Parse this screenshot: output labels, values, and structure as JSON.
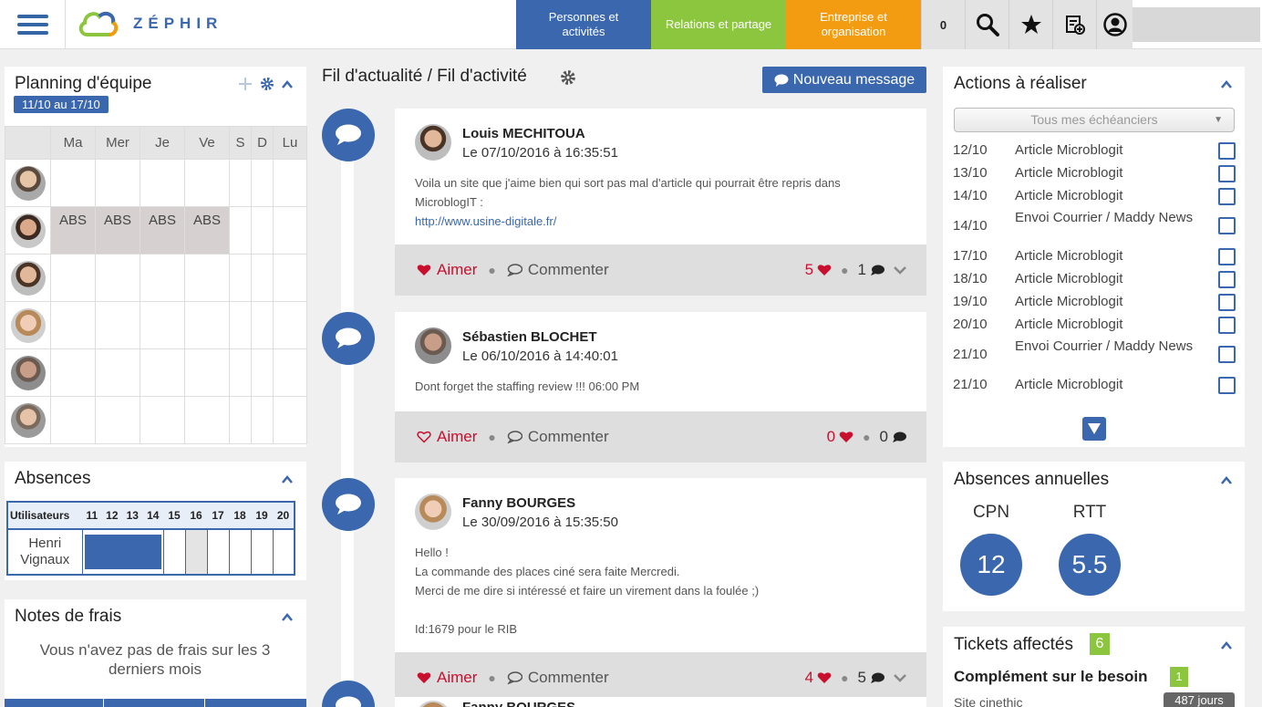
{
  "brand": {
    "name": "ZÉPHIR"
  },
  "nav": {
    "tabs": [
      {
        "label": "Personnes et activités",
        "color": "#3a67ae"
      },
      {
        "label": "Relations et partage",
        "color": "#8cc63f"
      },
      {
        "label": "Entreprise et organisation",
        "color": "#f39c12"
      }
    ],
    "counter": "0"
  },
  "planning": {
    "title": "Planning d'équipe",
    "range": "11/10 au 17/10",
    "days": [
      "Ma",
      "Mer",
      "Je",
      "Ve",
      "S",
      "D",
      "Lu"
    ],
    "abs_label": "ABS"
  },
  "absences": {
    "title": "Absences",
    "header_users": "Utilisateurs",
    "days": [
      "11",
      "12",
      "13",
      "14",
      "15",
      "16",
      "17",
      "18",
      "19",
      "20"
    ],
    "user": "Henri Vignaux"
  },
  "notes": {
    "title": "Notes de frais",
    "empty": "Vous n'avez pas de frais sur les 3 derniers mois"
  },
  "feed": {
    "title": "Fil d'actualité / Fil d'activité",
    "new_message": "Nouveau message",
    "like_label": "Aimer",
    "comment_label": "Commenter",
    "posts": [
      {
        "author": "Louis MECHITOUA",
        "date": "Le 07/10/2016 à 16:35:51",
        "line1": "Voila un site que j'aime bien qui sort pas mal d'article qui pourrait être repris dans",
        "line2": "MicroblogIT :",
        "link": "http://www.usine-digitale.fr/",
        "likes": "5",
        "comments": "1"
      },
      {
        "author": "Sébastien BLOCHET",
        "date": "Le 06/10/2016 à 14:40:01",
        "line1": "Dont forget the staffing review !!! 06:00 PM",
        "likes": "0",
        "comments": "0"
      },
      {
        "author": "Fanny BOURGES",
        "date": "Le 30/09/2016 à 15:35:50",
        "line1": "Hello !",
        "line2": "La commande des places ciné sera faite Mercredi.",
        "line3": "Merci de me dire si intéressé et faire un virement dans la foulée ;)",
        "line4": "Id:1679 pour le RIB",
        "likes": "4",
        "comments": "5"
      },
      {
        "author": "Fanny BOURGES"
      }
    ]
  },
  "actions": {
    "title": "Actions à réaliser",
    "filter": "Tous mes échéanciers",
    "items": [
      {
        "date": "12/10",
        "label": "Article Microblogit"
      },
      {
        "date": "13/10",
        "label": "Article Microblogit"
      },
      {
        "date": "14/10",
        "label": "Article Microblogit"
      },
      {
        "date": "14/10",
        "label": "Envoi Courrier / Maddy News"
      },
      {
        "date": "17/10",
        "label": "Article Microblogit"
      },
      {
        "date": "18/10",
        "label": "Article Microblogit"
      },
      {
        "date": "19/10",
        "label": "Article Microblogit"
      },
      {
        "date": "20/10",
        "label": "Article Microblogit"
      },
      {
        "date": "21/10",
        "label": "Envoi Courrier / Maddy News"
      },
      {
        "date": "21/10",
        "label": "Article Microblogit"
      }
    ]
  },
  "annual": {
    "title": "Absences annuelles",
    "cpn_label": "CPN",
    "cpn_value": "12",
    "rtt_label": "RTT",
    "rtt_value": "5.5"
  },
  "tickets": {
    "title": "Tickets affectés",
    "count": "6",
    "item_title": "Complément sur le besoin",
    "item_count": "1",
    "item_sub": "Site cinethic",
    "item_age": "487 jours"
  },
  "colors": {
    "accent": "#3a67ae",
    "like": "#c8102e",
    "green": "#8cc63f",
    "orange": "#f39c12"
  }
}
